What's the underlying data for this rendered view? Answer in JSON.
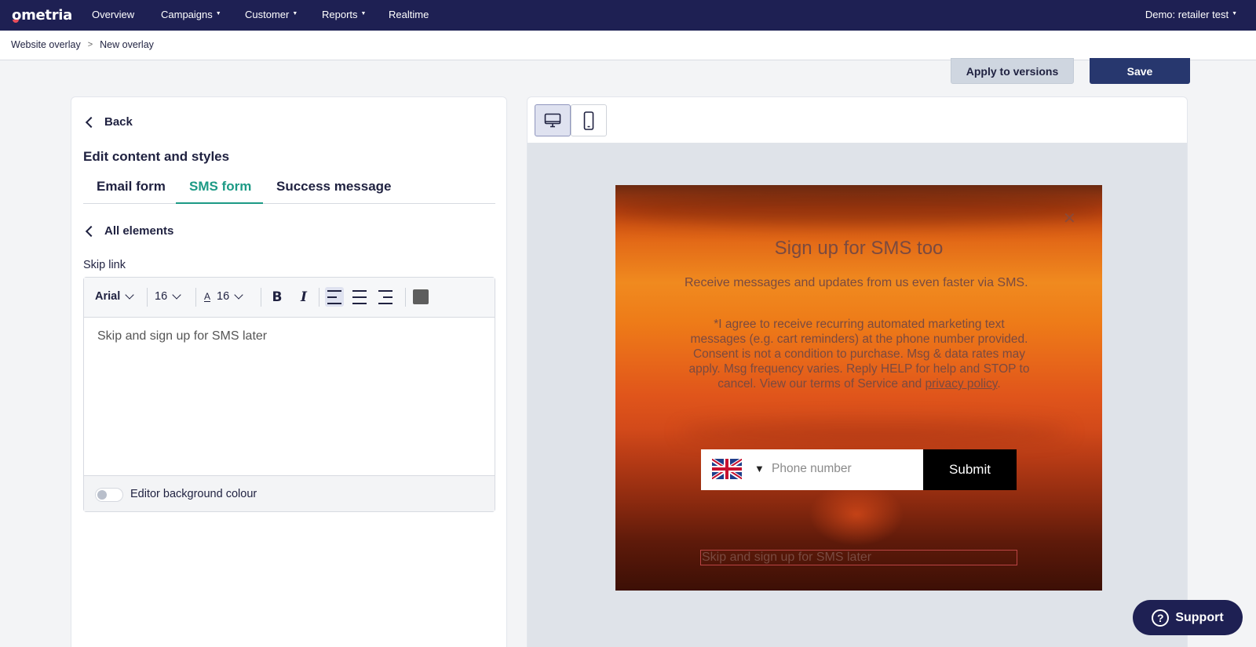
{
  "nav": {
    "logo": "ometria",
    "items": [
      {
        "label": "Overview",
        "has_menu": false
      },
      {
        "label": "Campaigns",
        "has_menu": true
      },
      {
        "label": "Customer",
        "has_menu": true
      },
      {
        "label": "Reports",
        "has_menu": true
      },
      {
        "label": "Realtime",
        "has_menu": false
      }
    ],
    "account": "Demo: retailer test"
  },
  "breadcrumb": {
    "items": [
      "Website overlay",
      "New overlay"
    ],
    "separator": ">"
  },
  "actions": {
    "apply_label": "Apply to versions",
    "save_label": "Save"
  },
  "editor_panel": {
    "back_label": "Back",
    "title": "Edit content and styles",
    "tabs": [
      {
        "label": "Email form",
        "active": false
      },
      {
        "label": "SMS form",
        "active": true
      },
      {
        "label": "Success message",
        "active": false
      }
    ],
    "all_elements_label": "All elements",
    "field_label": "Skip link",
    "toolbar": {
      "font": "Arial",
      "font_size": "16",
      "line_height": "16",
      "bold": "B",
      "italic": "I",
      "alignment": "left",
      "text_color": "#5d5d5d"
    },
    "content": "Skip and sign up for SMS later",
    "bg_toggle_label": "Editor background colour",
    "bg_toggle_on": false
  },
  "preview": {
    "device": "desktop",
    "overlay": {
      "title": "Sign up for SMS too",
      "subtitle": "Receive messages and updates from us even faster via SMS.",
      "legal": "*I agree to receive recurring automated marketing text messages (e.g. cart reminders) at the phone number provided. Consent is not a condition to purchase. Msg & data rates may apply. Msg frequency varies. Reply HELP for help and STOP to cancel. View our terms of Service and ",
      "legal_link": "privacy policy",
      "legal_end": ".",
      "country": "United Kingdom",
      "phone_placeholder": "Phone number",
      "submit_label": "Submit",
      "skip_text": "Skip and sign up for SMS later"
    }
  },
  "support_label": "Support",
  "colors": {
    "nav_bg": "#1e2053",
    "accent_tab": "#1c9a85",
    "save_bg": "#27376e",
    "apply_bg": "#cfd6e0"
  }
}
